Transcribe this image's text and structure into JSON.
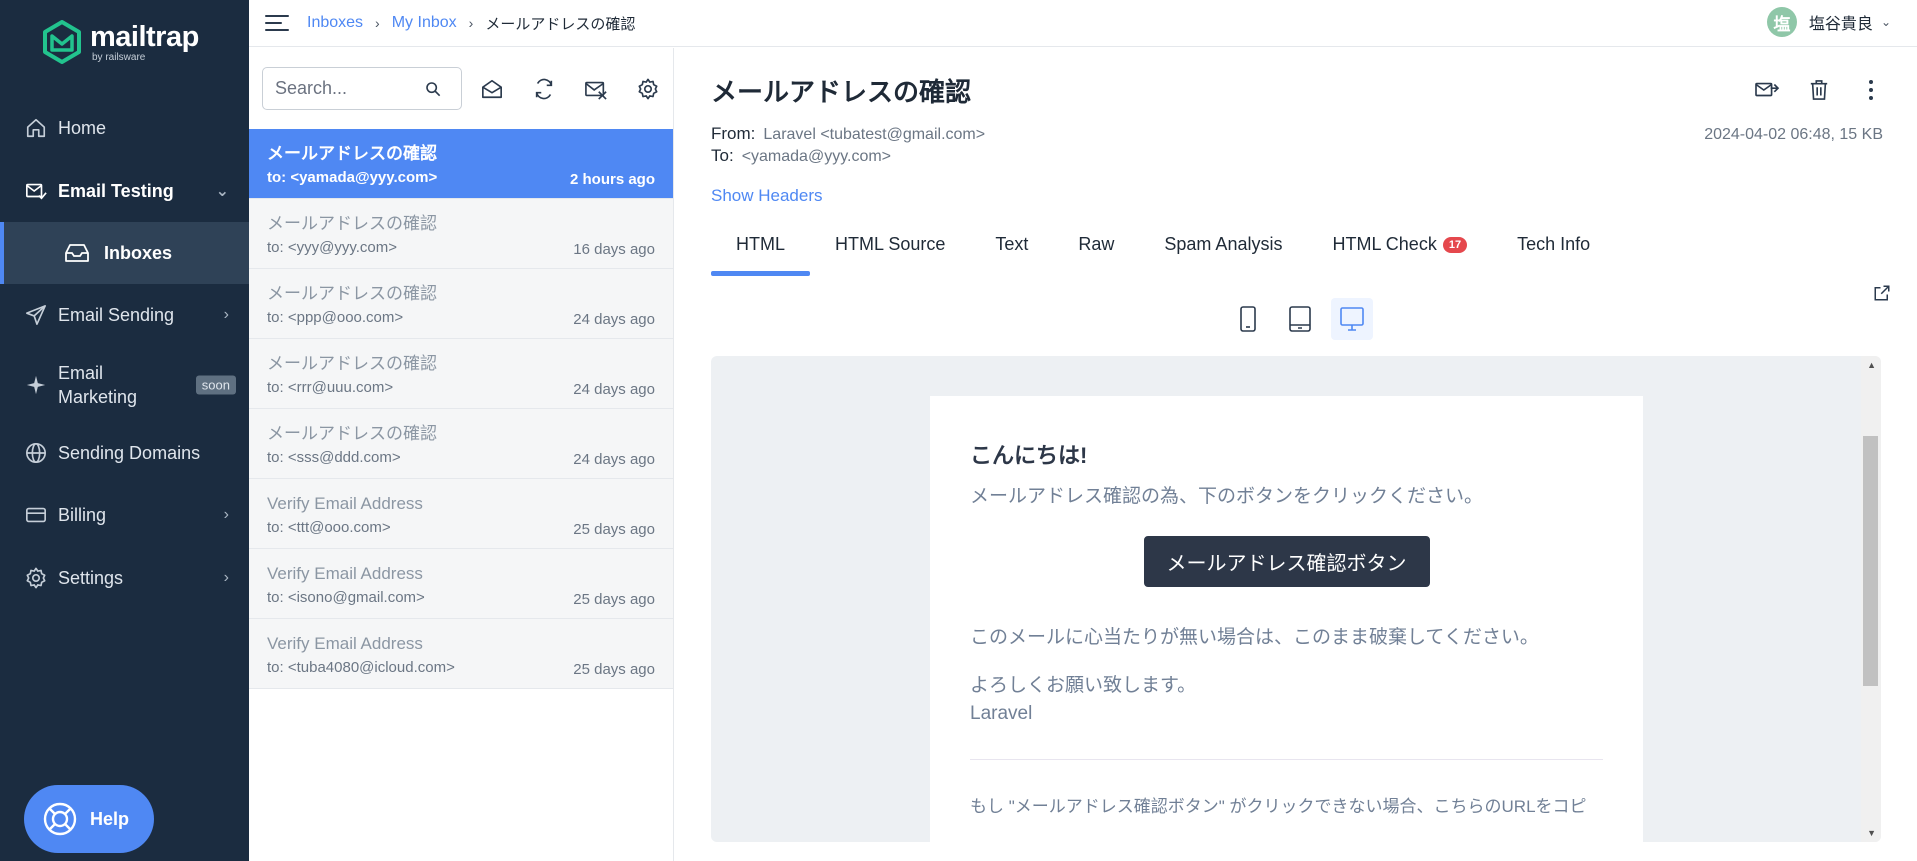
{
  "app": {
    "brand": "mailtrap",
    "brand_sub": "by railsware"
  },
  "sidebar": {
    "items": [
      {
        "label": "Home",
        "icon": "home-icon"
      },
      {
        "label": "Email Testing",
        "icon": "email-testing-icon"
      },
      {
        "label": "Inboxes",
        "icon": "inbox-icon"
      },
      {
        "label": "Email Sending",
        "icon": "send-icon"
      },
      {
        "label": "Email",
        "label2": "Marketing",
        "badge": "soon",
        "icon": "sparkle-icon"
      },
      {
        "label": "Sending Domains",
        "icon": "globe-icon"
      },
      {
        "label": "Billing",
        "icon": "billing-icon"
      },
      {
        "label": "Settings",
        "icon": "gear-icon"
      }
    ],
    "help_label": "Help"
  },
  "topbar": {
    "breadcrumbs": [
      "Inboxes",
      "My Inbox",
      "メールアドレスの確認"
    ],
    "separator": "›",
    "user_name": "塩谷貴良",
    "user_initial": "塩"
  },
  "list": {
    "search_placeholder": "Search...",
    "messages": [
      {
        "subject": "メールアドレスの確認",
        "to": "to: <yamada@yyy.com>",
        "time": "2 hours ago"
      },
      {
        "subject": "メールアドレスの確認",
        "to": "to: <yyy@yyy.com>",
        "time": "16 days ago"
      },
      {
        "subject": "メールアドレスの確認",
        "to": "to: <ppp@ooo.com>",
        "time": "24 days ago"
      },
      {
        "subject": "メールアドレスの確認",
        "to": "to: <rrr@uuu.com>",
        "time": "24 days ago"
      },
      {
        "subject": "メールアドレスの確認",
        "to": "to: <sss@ddd.com>",
        "time": "24 days ago"
      },
      {
        "subject": "Verify Email Address",
        "to": "to: <ttt@ooo.com>",
        "time": "25 days ago"
      },
      {
        "subject": "Verify Email Address",
        "to": "to: <isono@gmail.com>",
        "time": "25 days ago"
      },
      {
        "subject": "Verify Email Address",
        "to": "to: <tuba4080@icloud.com>",
        "time": "25 days ago"
      }
    ]
  },
  "message": {
    "title": "メールアドレスの確認",
    "from_label": "From:",
    "from_value": "Laravel <tubatest@gmail.com>",
    "to_label": "To:",
    "to_value": "<yamada@yyy.com>",
    "date": "2024-04-02 06:48, 15 KB",
    "show_headers": "Show Headers",
    "tabs": [
      {
        "label": "HTML"
      },
      {
        "label": "HTML Source"
      },
      {
        "label": "Text"
      },
      {
        "label": "Raw"
      },
      {
        "label": "Spam Analysis"
      },
      {
        "label": "HTML Check",
        "badge": "17"
      },
      {
        "label": "Tech Info"
      }
    ],
    "active_tab": "HTML"
  },
  "email_body": {
    "greeting": "こんにちは!",
    "line1": "メールアドレス確認の為、下のボタンをクリックください。",
    "button": "メールアドレス確認ボタン",
    "line2": "このメールに心当たりが無い場合は、このまま破棄してください。",
    "line3": "よろしくお願い致します。",
    "signature": "Laravel",
    "footnote": "もし \"メールアドレス確認ボタン\" がクリックできない場合、こちらのURLをコピ"
  },
  "colors": {
    "sidebar_bg": "#1b2c40",
    "accent": "#4f88f3",
    "badge_red": "#e5484d",
    "brand_green": "#22c38e"
  }
}
